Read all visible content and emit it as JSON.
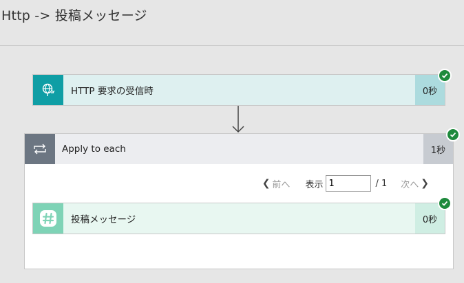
{
  "header": {
    "title": "Http -> 投稿メッセージ"
  },
  "trigger": {
    "label": "HTTP 要求の受信時",
    "duration": "0秒",
    "status": "succeeded"
  },
  "loop": {
    "label": "Apply to each",
    "duration": "1秒",
    "status": "succeeded",
    "pager": {
      "prev_label": "前へ",
      "show_label": "表示",
      "page_value": "1",
      "total_label": "/ 1",
      "next_label": "次へ"
    },
    "action": {
      "label": "投稿メッセージ",
      "duration": "0秒",
      "status": "succeeded"
    }
  },
  "colors": {
    "trigger_accent": "#0f9ea5",
    "trigger_body": "#def0f0",
    "trigger_duration": "#acdbde",
    "loop_accent": "#6c7682",
    "action_accent": "#7ed3b6",
    "action_body": "#e8f7f1",
    "action_duration": "#cfeee3",
    "success": "#1e8a3c"
  },
  "icons": {
    "trigger": "http-globe-icon",
    "loop": "loop-icon",
    "action": "slack-hash-icon",
    "status": "check-icon"
  }
}
